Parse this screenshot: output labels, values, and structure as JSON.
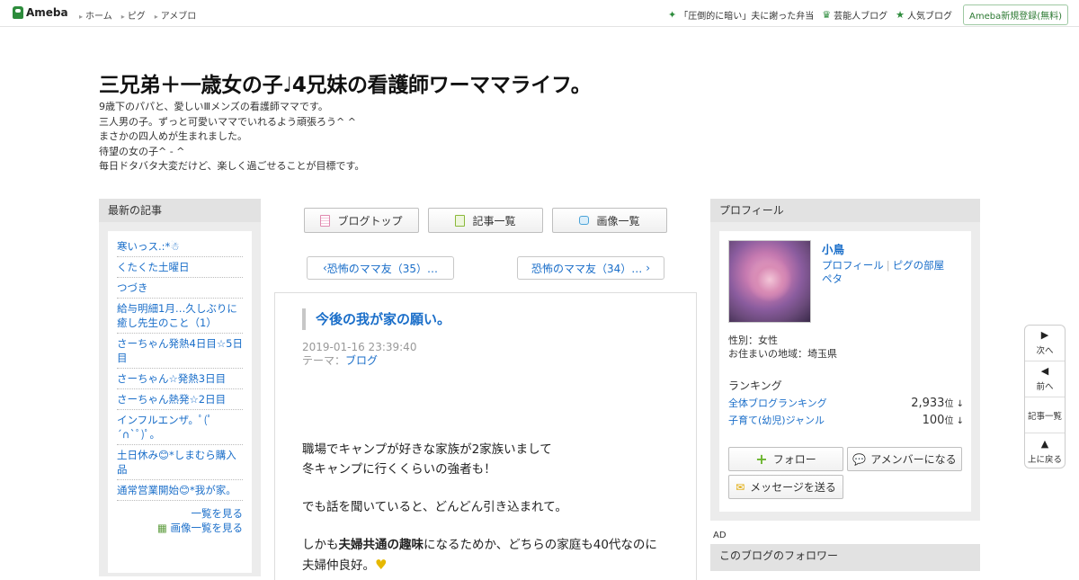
{
  "header": {
    "logo": "Ameba",
    "nav": [
      "ホーム",
      "ピグ",
      "アメブロ"
    ],
    "right": [
      {
        "icon": "sparkle-icon",
        "label": "「圧倒的に暗い」夫に謝った弁当"
      },
      {
        "icon": "crown-icon",
        "label": "芸能人ブログ"
      },
      {
        "icon": "star-icon",
        "label": "人気ブログ"
      }
    ],
    "register": "Ameba新規登録(無料)"
  },
  "blog": {
    "title": "三兄弟＋一歳女の子♩4兄妹の看護師ワーママライフ。",
    "description": [
      "9歳下のパパと、愛しいⅢメンズの看護師ママです。",
      "三人男の子。ずっと可愛いママでいれるよう頑張ろう^ ^",
      "まさかの四人めが生まれました。",
      "待望の女の子^ - ^",
      "毎日ドタバタ大変だけど、楽しく過ごせることが目標です。"
    ]
  },
  "left": {
    "heading": "最新の記事",
    "items": [
      "寒いっス.:*☃",
      "くたくた土曜日",
      "つづき",
      "給与明細1月…久しぶりに癒し先生のこと（1）",
      "さーちゃん発熱4日目☆5日目",
      "さーちゃん☆発熱3日目",
      "さーちゃん熱発☆2日目",
      "インフルエンザ。ﾟ(ﾟ´∩`ﾟ)ﾟ。",
      "土日休み😊*しまむら購入品",
      "通常営業開始😊*我が家。"
    ],
    "more": "一覧を見る",
    "images": "画像一覧を見る"
  },
  "buttons": {
    "top": "ブログトップ",
    "list": "記事一覧",
    "images": "画像一覧"
  },
  "pager": {
    "prev": "恐怖のママ友（35）…",
    "next": "恐怖のママ友（34）…"
  },
  "article": {
    "title": "今後の我が家の願い。",
    "date": "2019-01-16 23:39:40",
    "theme_label": "テーマ：",
    "theme": "ブログ",
    "p1a": "職場でキャンプが好きな家族が2家族いまして",
    "p1b": "冬キャンプに行くくらいの強者も！",
    "p2": "でも話を聞いていると、どんどん引き込まれて。",
    "p3a": "しかも",
    "p3bold": "夫婦共通の趣味",
    "p3b": "になるためか、どちらの家庭も40代なのに",
    "p4": "夫婦仲良好。"
  },
  "profile": {
    "heading": "プロフィール",
    "name": "小鳥",
    "link1": "プロフィール",
    "link2": "ピグの部屋",
    "link3": "ペタ",
    "gender": "性別：女性",
    "area": "お住まいの地域：埼玉県",
    "ranking_heading": "ランキング",
    "rank1_label": "全体ブログランキング",
    "rank1_value": "2,933",
    "rank2_label": "子育て(幼児)ジャンル",
    "rank2_value": "100",
    "rank_unit": "位 ↓",
    "follow": "フォロー",
    "amember": "アメンバーになる",
    "message": "メッセージを送る"
  },
  "ad": "AD",
  "followers_heading": "このブログのフォロワー",
  "sidenav": {
    "next": "次へ",
    "prev": "前へ",
    "list": "記事一覧",
    "top": "上に戻る"
  },
  "colors": {
    "link": "#1a6ec9",
    "ameba_green": "#2d8c3c",
    "panel": "#ececec"
  }
}
